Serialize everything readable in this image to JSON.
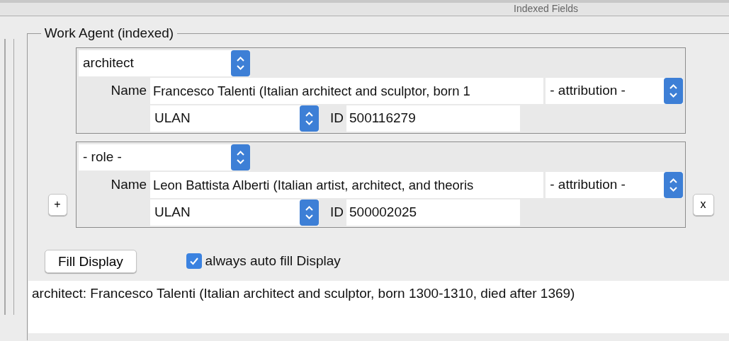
{
  "header": {
    "title": "Indexed Fields"
  },
  "section": {
    "legend": "Work Agent (indexed)"
  },
  "agents": [
    {
      "role": "architect",
      "name_label": "Name",
      "name": "Francesco Talenti (Italian architect and sculptor, born 1",
      "attribution": "- attribution -",
      "vocabulary": "ULAN",
      "id_label": "ID",
      "id": "500116279"
    },
    {
      "role": "- role -",
      "name_label": "Name",
      "name": "Leon Battista Alberti (Italian artist, architect, and theoris",
      "attribution": "- attribution -",
      "vocabulary": "ULAN",
      "id_label": "ID",
      "id": "500002025"
    }
  ],
  "add_button": "+",
  "remove_button": "x",
  "fill_button": "Fill Display",
  "auto_fill": {
    "label": "always auto fill Display",
    "checked": true
  },
  "display": "architect: Francesco Talenti (Italian architect and sculptor, born 1300-1310, died after 1369)"
}
